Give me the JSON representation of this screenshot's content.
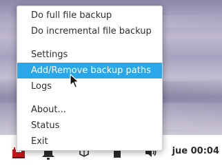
{
  "menu": {
    "items": [
      {
        "label": "Do full file backup"
      },
      {
        "label": "Do incremental file backup"
      },
      {
        "label": "Settings"
      },
      {
        "label": "Add/Remove backup paths"
      },
      {
        "label": "Logs"
      },
      {
        "label": "About..."
      },
      {
        "label": "Status"
      },
      {
        "label": "Exit"
      }
    ],
    "highlighted_item": "Add/Remove backup paths"
  },
  "panel": {
    "clock": "jue 00:04",
    "tray_icons": [
      "backup-tray-icon",
      "notification-bell-icon",
      "package-icon",
      "battery-icon",
      "volume-icon"
    ]
  },
  "colors": {
    "highlight": "#2aa7e9",
    "panel_background": "#ffffff",
    "backup_icon": "#c8141c"
  }
}
